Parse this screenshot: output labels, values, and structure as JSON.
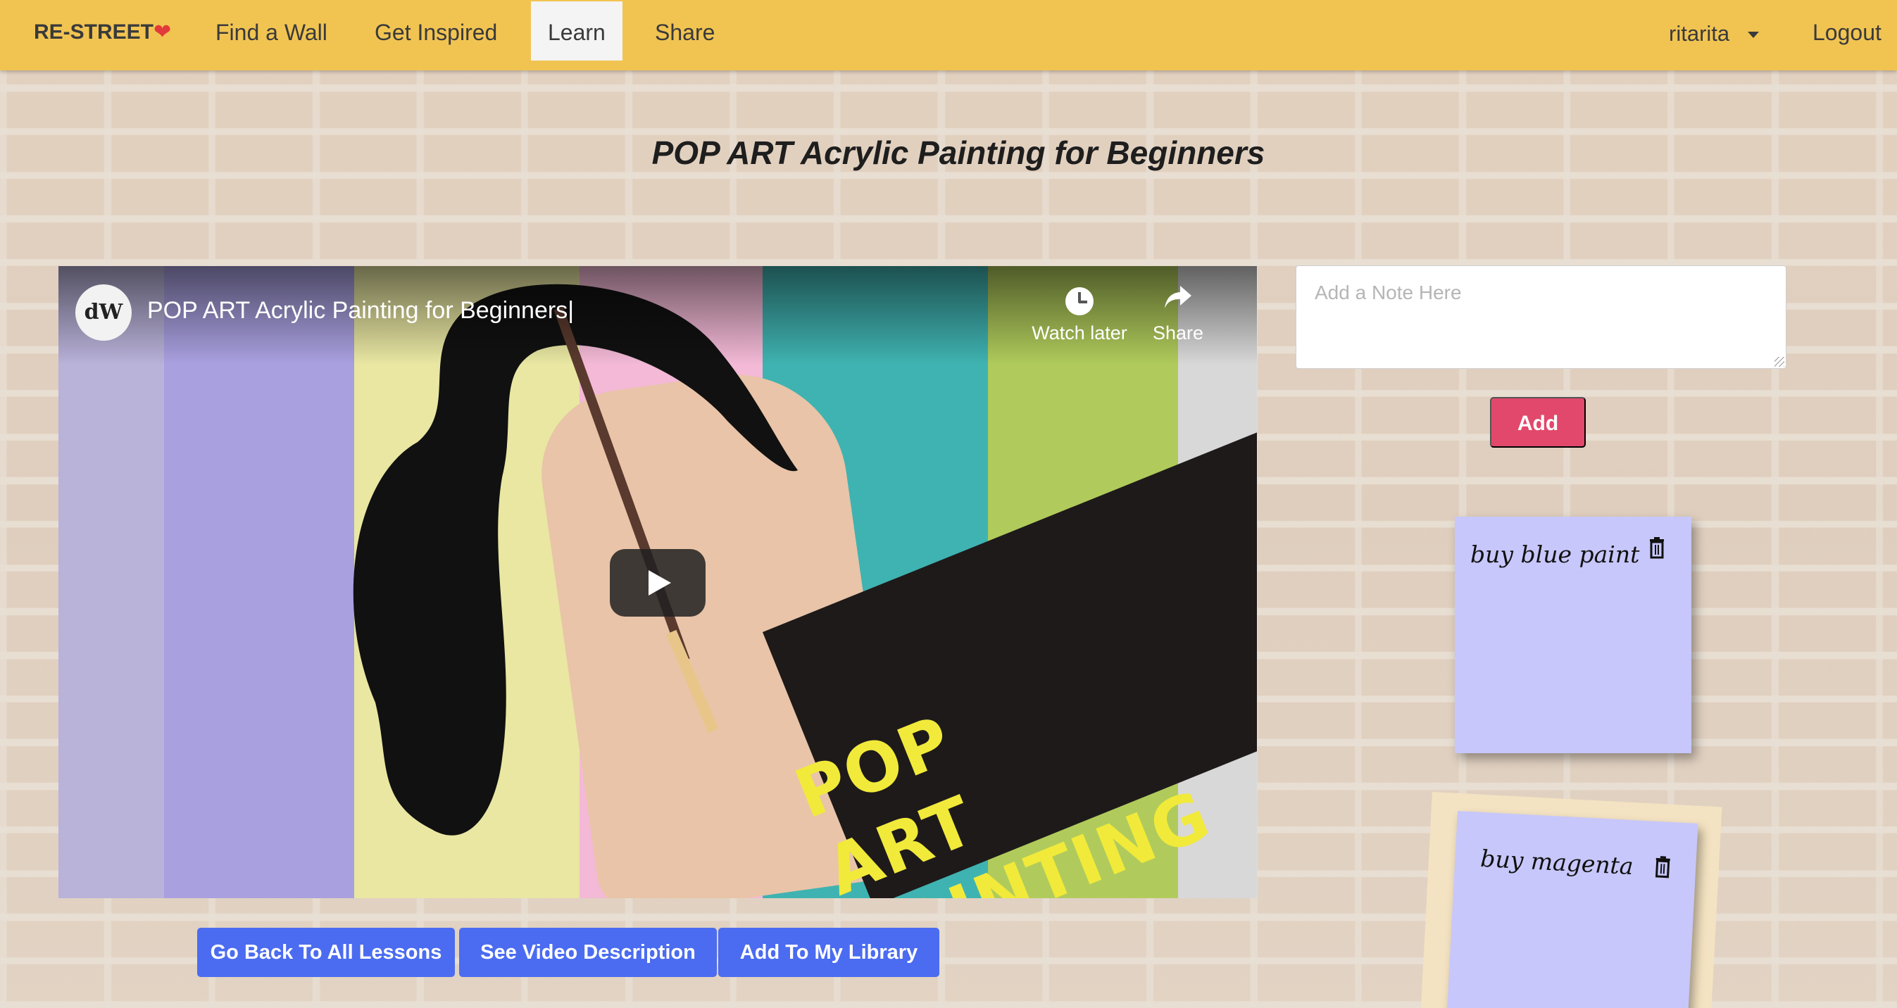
{
  "navbar": {
    "brand": "RE-STREET",
    "brand_heart": "❤",
    "links": [
      {
        "label": "Find a Wall",
        "active": false
      },
      {
        "label": "Get Inspired",
        "active": false
      },
      {
        "label": "Learn",
        "active": true
      },
      {
        "label": "Share",
        "active": false
      }
    ],
    "user": "ritarita",
    "logout": "Logout"
  },
  "page": {
    "title": "POP ART Acrylic Painting for Beginners"
  },
  "video": {
    "channel_avatar": "dW",
    "title": "POP ART Acrylic Painting for Beginners|",
    "watch_later_label": "Watch later",
    "share_label": "Share",
    "thumbnail_text_line1": "POP",
    "thumbnail_text_line2": "ART PAINTING",
    "icons": [
      "clock-icon",
      "share-arrow-icon",
      "play-icon"
    ]
  },
  "lesson_buttons": {
    "back": "Go Back To All Lessons",
    "description": "See Video Description",
    "library": "Add To My Library"
  },
  "notes": {
    "placeholder": "Add a Note Here",
    "value": "",
    "add_label": "Add",
    "items": [
      {
        "text": "buy blue paint"
      },
      {
        "text": "buy magenta"
      }
    ]
  },
  "colors": {
    "navbar": "#f1c452",
    "primary_button": "#4b6cf0",
    "add_button": "#e2486b",
    "sticky_note": "#c7c7fb",
    "heart": "#e23a3a"
  }
}
